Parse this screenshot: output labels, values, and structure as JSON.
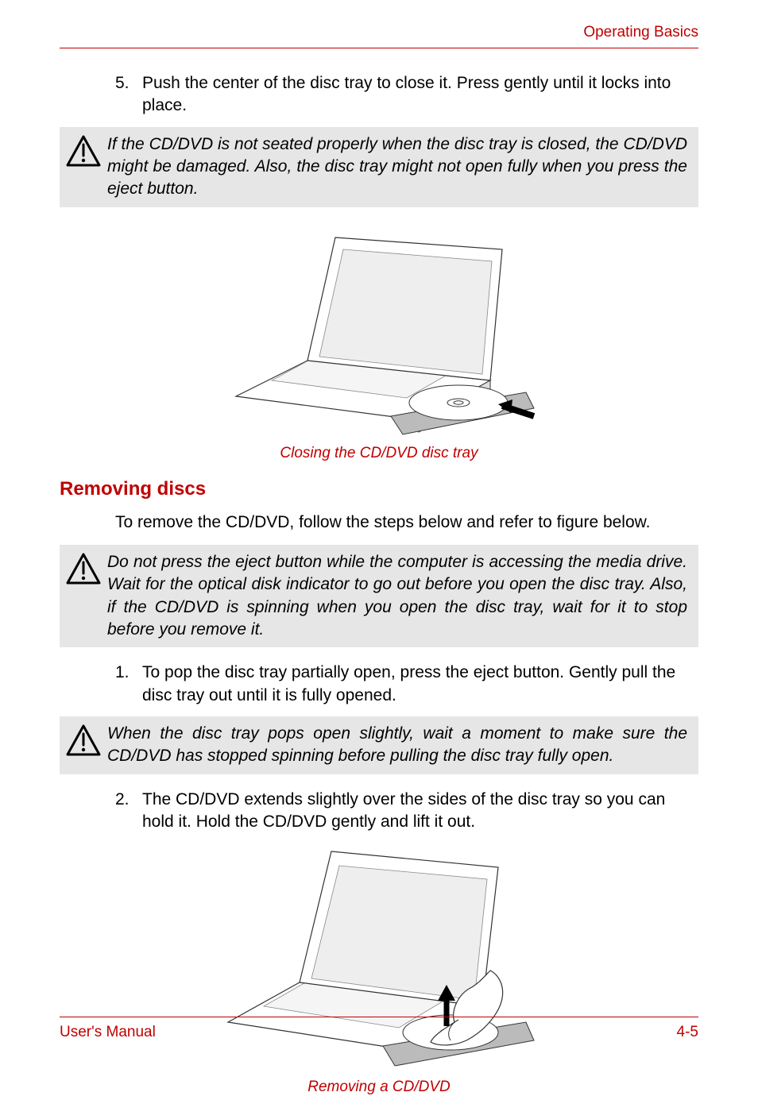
{
  "header": {
    "section_title": "Operating Basics"
  },
  "steps_a": [
    {
      "num": "5.",
      "text": "Push the center of the disc tray to close it. Press gently until it locks into place."
    }
  ],
  "caution1": "If the CD/DVD is not seated properly when the disc tray is closed, the CD/DVD might be damaged. Also, the disc tray might not open fully when you press the eject button.",
  "figure1_caption": "Closing the CD/DVD disc tray",
  "section_heading": "Removing discs",
  "intro_para": "To remove the CD/DVD, follow the steps below and refer to figure below.",
  "caution2": "Do not press the eject button while the computer is accessing the media drive. Wait for the optical disk indicator to go out before you open the disc tray. Also, if the CD/DVD is spinning when you open the disc tray, wait for it to stop before you remove it.",
  "steps_b": [
    {
      "num": "1.",
      "text": "To pop the disc tray partially open, press the eject button. Gently pull the disc tray out until it is fully opened."
    }
  ],
  "caution3": "When the disc tray pops open slightly, wait a moment to make sure the CD/DVD has stopped spinning before pulling the disc tray fully open.",
  "steps_c": [
    {
      "num": "2.",
      "text": "The CD/DVD extends slightly over the sides of the disc tray so you can hold it. Hold the CD/DVD gently and lift it out."
    }
  ],
  "figure2_caption": "Removing a CD/DVD",
  "footer": {
    "left": "User's Manual",
    "right": "4-5"
  }
}
